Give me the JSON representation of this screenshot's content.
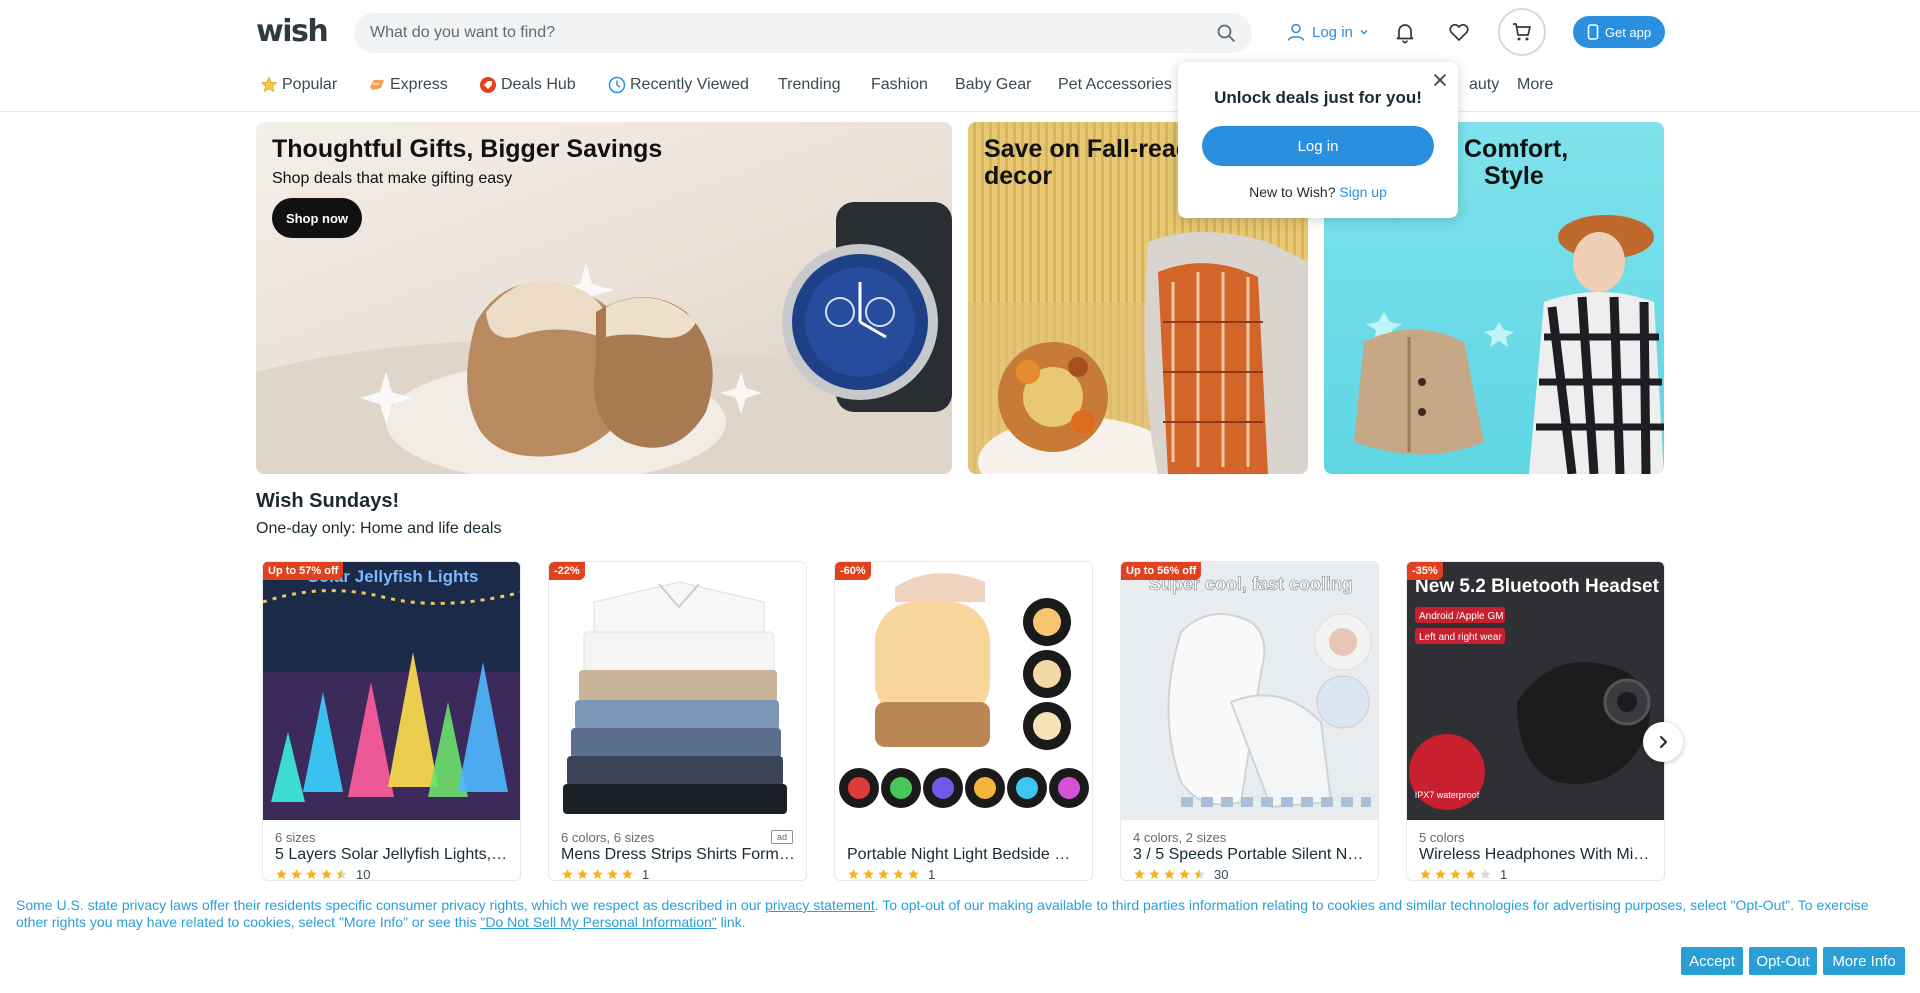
{
  "header": {
    "logo": "wish",
    "search_placeholder": "What do you want to find?",
    "login_label": "Log in",
    "get_app_label": "Get app"
  },
  "nav": {
    "items": [
      {
        "label": "Popular",
        "icon": "star-icon"
      },
      {
        "label": "Express",
        "icon": "express-icon"
      },
      {
        "label": "Deals Hub",
        "icon": "deals-icon"
      },
      {
        "label": "Recently Viewed",
        "icon": "clock-icon"
      },
      {
        "label": "Trending"
      },
      {
        "label": "Fashion"
      },
      {
        "label": "Baby Gear"
      },
      {
        "label": "Pet Accessories"
      },
      {
        "label": "auty"
      },
      {
        "label": "More"
      }
    ]
  },
  "popup": {
    "title": "Unlock deals just for you!",
    "login_button": "Log in",
    "new_to": "New to Wish?",
    "signup": "Sign up"
  },
  "banners": [
    {
      "title": "Thoughtful Gifts, Bigger Savings",
      "subtitle": "Shop deals that make gifting easy",
      "button": "Shop now"
    },
    {
      "title": "Save on Fall-reac",
      "title2": "decor"
    },
    {
      "title": "Comfort,",
      "title2": "Style"
    }
  ],
  "section": {
    "title": "Wish Sundays!",
    "subtitle": "One-day only: Home and life deals"
  },
  "products": [
    {
      "badge": "Up to 57% off",
      "options": "6 sizes",
      "name": "5 Layers Solar Jellyfish Lights, …",
      "rating": 4.5,
      "count": "10",
      "image_text": "Solar Jellyfish Lights"
    },
    {
      "badge": "-22%",
      "options": "6 colors, 6 sizes",
      "name": "Mens Dress Strips Shirts Form…",
      "rating": 5,
      "count": "1",
      "ad": "ad"
    },
    {
      "badge": "-60%",
      "options": "",
      "name": "Portable Night Light Bedside …",
      "rating": 5,
      "count": "1"
    },
    {
      "badge": "Up to 56% off",
      "options": "4 colors, 2 sizes",
      "name": "3 / 5 Speeds Portable Silent N…",
      "rating": 4.5,
      "count": "30",
      "image_text": "Super cool, fast cooling"
    },
    {
      "badge": "-35%",
      "options": "5 colors",
      "name": "Wireless Headphones With Mi…",
      "rating": 4,
      "count": "1",
      "image_text": "New 5.2 Bluetooth Headset",
      "image_sub1": "Android /Apple GM",
      "image_sub2": "Left and right wear",
      "image_sub3": "IPX7 waterproof"
    }
  ],
  "cookie": {
    "text_1": "Some U.S. state privacy laws offer their residents specific consumer privacy rights, which we respect as described in our ",
    "link_1": "privacy statement",
    "text_2": ". To opt-out of our making available to third parties information relating to cookies and similar technologies for advertising purposes, select \"Opt-Out\". To exercise other rights you may have related to cookies, select \"More Info\" or see this ",
    "link_2": "\"Do Not Sell My Personal Information\"",
    "text_3": " link.",
    "accept": "Accept",
    "opt_out": "Opt-Out",
    "more_info": "More Info"
  },
  "colors": {
    "accent": "#2b8fe0",
    "badge": "#e0411f",
    "cookie": "#2a9fd6",
    "star": "#f4b41a"
  }
}
